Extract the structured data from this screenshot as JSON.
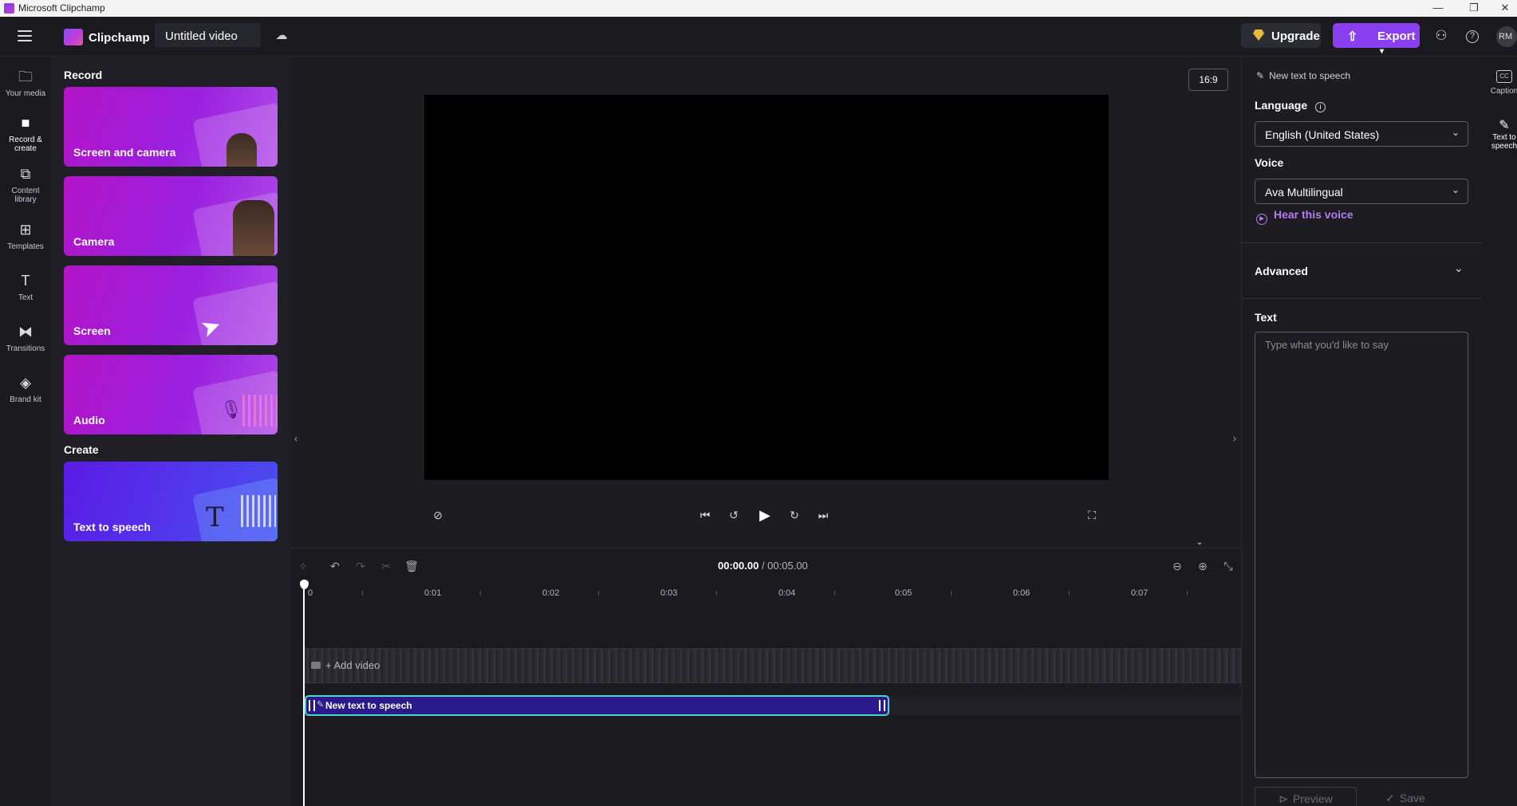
{
  "window": {
    "title": "Microsoft Clipchamp",
    "minimize": "—",
    "maximize": "❐",
    "close": "✕"
  },
  "topbar": {
    "brand": "Clipchamp",
    "video_title": "Untitled video",
    "upgrade_label": "Upgrade",
    "export_label": "Export",
    "avatar_initials": "RM"
  },
  "leftnav": {
    "items": [
      {
        "label": "Your media",
        "icon": "folder-icon"
      },
      {
        "label": "Record & create",
        "icon": "video-camera-icon"
      },
      {
        "label": "Content library",
        "icon": "library-icon"
      },
      {
        "label": "Templates",
        "icon": "templates-icon"
      },
      {
        "label": "Text",
        "icon": "text-icon"
      },
      {
        "label": "Transitions",
        "icon": "transitions-icon"
      },
      {
        "label": "Brand kit",
        "icon": "brand-kit-icon"
      }
    ],
    "active": "Record & create"
  },
  "panel": {
    "record_title": "Record",
    "create_title": "Create",
    "cards": [
      {
        "label": "Screen and camera"
      },
      {
        "label": "Camera"
      },
      {
        "label": "Screen"
      },
      {
        "label": "Audio"
      }
    ],
    "create_cards": [
      {
        "label": "Text to speech"
      }
    ]
  },
  "preview": {
    "aspect_ratio": "16:9"
  },
  "timeline": {
    "current_time": "00:00.00",
    "separator": " / ",
    "total_time": "00:05.00",
    "ticks": [
      "0",
      "0:01",
      "0:02",
      "0:03",
      "0:04",
      "0:05",
      "0:06",
      "0:07"
    ],
    "add_video": "+ Add video",
    "clip_label": "New text to speech"
  },
  "rpanel": {
    "header": "New text to speech",
    "language_label": "Language",
    "language_value": "English (United States)",
    "voice_label": "Voice",
    "voice_value": "Ava Multilingual",
    "hear_voice": "Hear this voice",
    "advanced_label": "Advanced",
    "text_label": "Text",
    "text_placeholder": "Type what you'd like to say",
    "preview_btn": "Preview",
    "save_btn": "Save"
  },
  "rrail": {
    "items": [
      {
        "label": "Caption"
      },
      {
        "label": "Text to speech"
      }
    ]
  },
  "colors": {
    "accent": "#8a3ff0",
    "clip_border": "#4ad5cf",
    "clip_fill": "#2b1a8a",
    "link": "#b47cf5"
  }
}
